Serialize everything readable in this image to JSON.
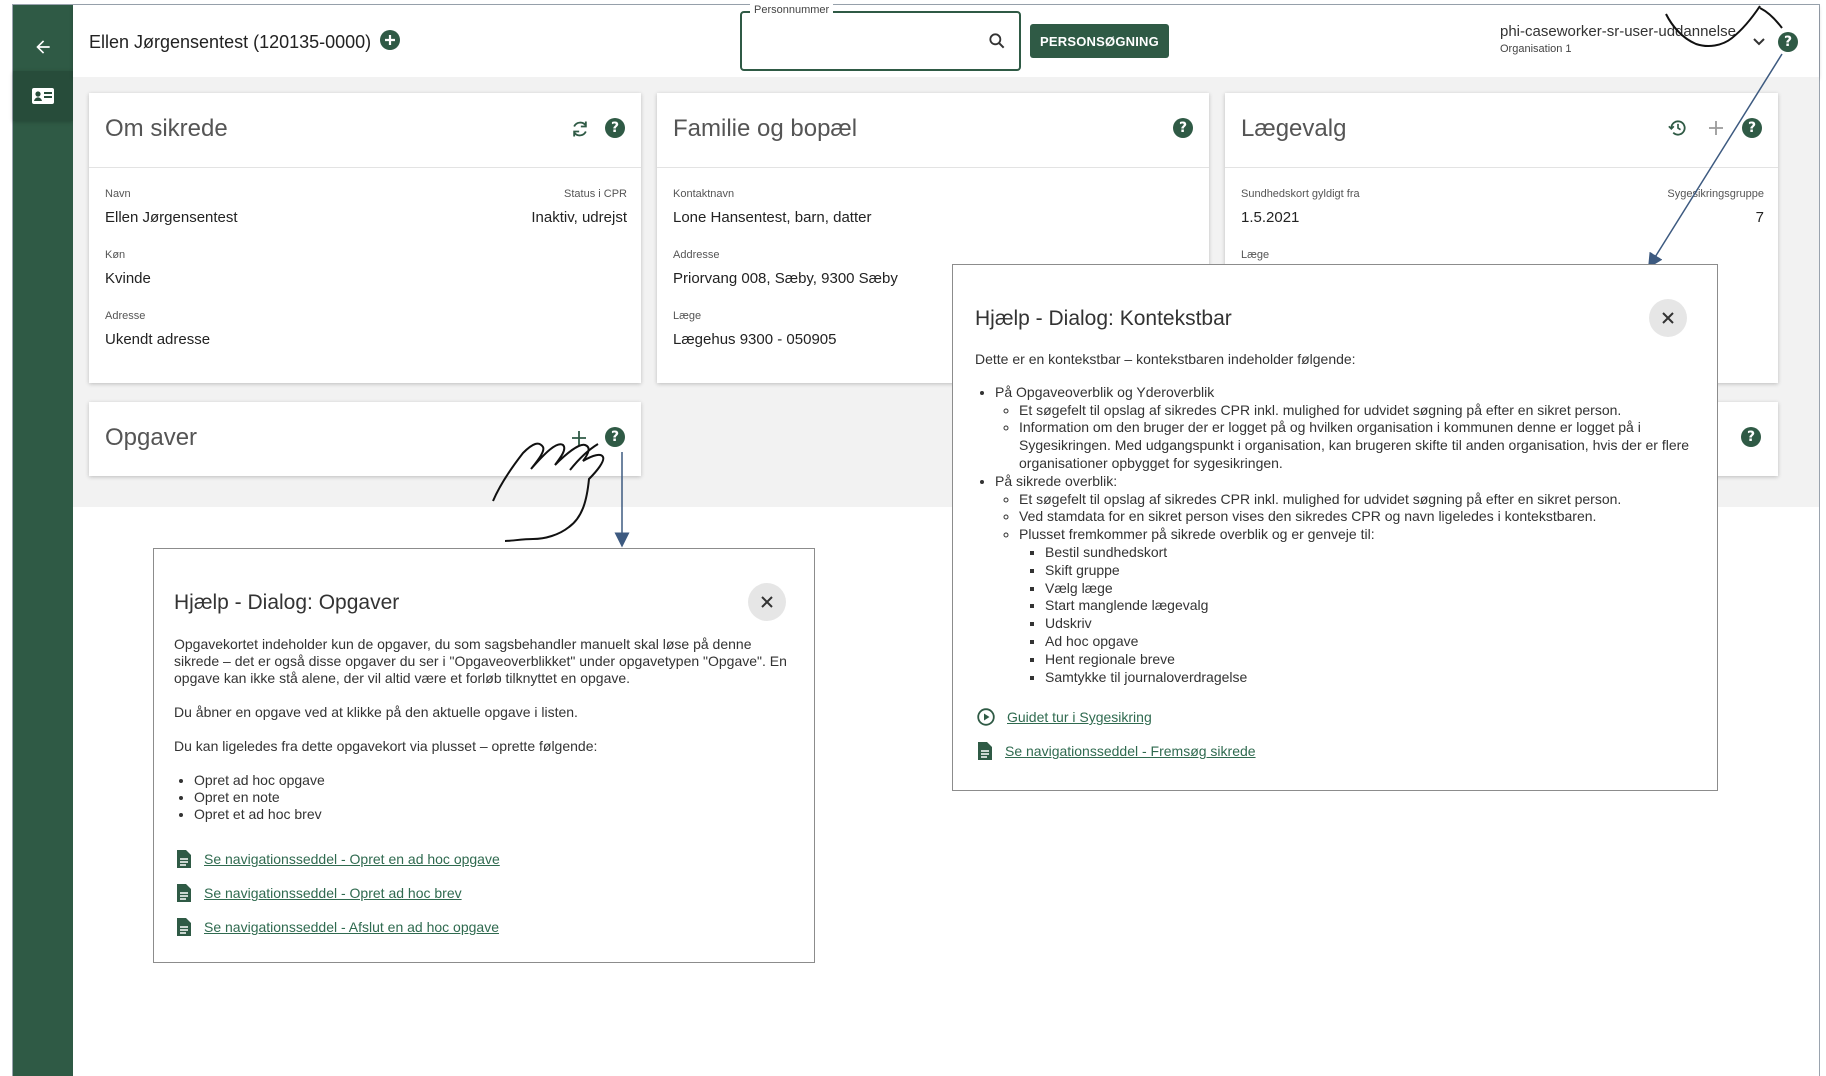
{
  "header": {
    "patient_name": "Ellen Jørgensentest (120135-0000)",
    "search_legend": "Personnummer",
    "search_value": "",
    "person_search_button": "PERSONSØGNING",
    "user_name": "phi-caseworker-sr-user-uddannelse",
    "user_org": "Organisation 1"
  },
  "om_sikrede": {
    "title": "Om sikrede",
    "name_label": "Navn",
    "name_value": "Ellen Jørgensentest",
    "status_label": "Status i CPR",
    "status_value": "Inaktiv, udrejst",
    "gender_label": "Køn",
    "gender_value": "Kvinde",
    "address_label": "Adresse",
    "address_value": "Ukendt adresse"
  },
  "familie": {
    "title": "Familie og bopæl",
    "contact_label": "Kontaktnavn",
    "contact_value": "Lone Hansentest, barn, datter",
    "address_label": "Addresse",
    "address_value": "Priorvang 008, Sæby, 9300 Sæby",
    "doctor_label": "Læge",
    "doctor_value": "Lægehus 9300 - 050905"
  },
  "laegevalg": {
    "title": "Lægevalg",
    "card_valid_label": "Sundhedskort gyldigt fra",
    "card_valid_value": "1.5.2021",
    "group_label": "Sygesikringsgruppe",
    "group_value": "7",
    "doctor_label": "Læge"
  },
  "opgaver": {
    "title": "Opgaver"
  },
  "dialog_opgaver": {
    "title": "Hjælp - Dialog: Opgaver",
    "para1": "Opgavekortet indeholder kun de opgaver, du som sagsbehandler manuelt skal løse på denne sikrede – det er også disse opgaver du ser i \"Opgaveoverblikket\" under opgavetypen \"Opgave\". En opgave kan ikke stå alene, der vil altid være et forløb tilknyttet en opgave.",
    "para2": "Du åbner en opgave ved at klikke på den aktuelle opgave i listen.",
    "para3": "Du kan ligeledes fra dette opgavekort via plusset – oprette følgende:",
    "items": [
      "Opret ad hoc opgave",
      "Opret en note",
      "Opret et ad hoc brev"
    ],
    "links": [
      "Se navigationsseddel - Opret en ad hoc opgave",
      "Se navigationsseddel - Opret ad hoc brev",
      "Se navigationsseddel - Afslut en ad hoc opgave"
    ]
  },
  "dialog_kontekstbar": {
    "title": "Hjælp - Dialog: Kontekstbar",
    "intro": "Dette er en kontekstbar – kontekstbaren indeholder følgende:",
    "section1": "På Opgaveoverblik og Yderoverblik",
    "section1_items": [
      "Et søgefelt til opslag af sikredes CPR inkl. mulighed for udvidet søgning på efter en sikret person.",
      "Information om den bruger der er logget på og hvilken organisation i kommunen denne er logget på i Sygesikringen. Med udgangspunkt i organisation, kan brugeren skifte til anden organisation, hvis der er flere organisationer opbygget for sygesikringen."
    ],
    "section2": "På sikrede overblik:",
    "section2_items": [
      "Et søgefelt til opslag af sikredes CPR inkl. mulighed for udvidet søgning på efter en sikret person.",
      "Ved stamdata for en sikret person vises den sikredes CPR og navn ligeledes i kontekstbaren.",
      "Plusset fremkommer på sikrede overblik og er genveje til:"
    ],
    "shortcuts": [
      "Bestil sundhedskort",
      "Skift gruppe",
      "Vælg læge",
      "Start manglende lægevalg",
      "Udskriv",
      "Ad hoc opgave",
      "Hent regionale breve",
      "Samtykke til journaloverdragelse"
    ],
    "tour_link": "Guidet tur i Sygesikring",
    "nav_link": "Se navigationsseddel - Fremsøg sikrede"
  },
  "colors": {
    "primary": "#2f5a45",
    "link": "#2f6a4f"
  }
}
